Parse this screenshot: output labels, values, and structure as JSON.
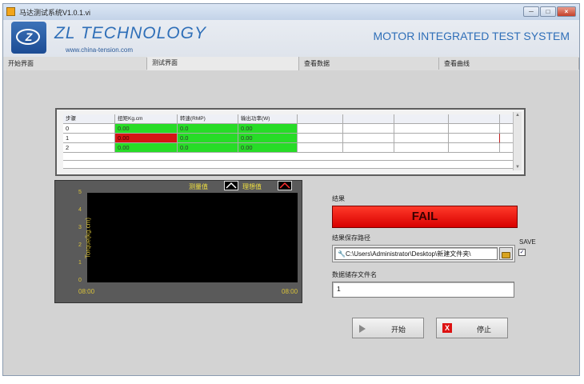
{
  "window": {
    "title": "马达测试系统V1.0.1.vi"
  },
  "header": {
    "logo_letter": "Z",
    "brand": "ZL TECHNOLOGY",
    "url": "www.china-tension.com",
    "system_name": "MOTOR INTEGRATED TEST SYSTEM"
  },
  "tabs": [
    {
      "label": "开始界面"
    },
    {
      "label": "测试界面"
    },
    {
      "label": "查看数据"
    },
    {
      "label": "查看曲线"
    }
  ],
  "table": {
    "columns": [
      "步骤",
      "扭矩Kg.cm",
      "转速(RMP)",
      "输出功率(W)",
      "",
      "",
      "",
      "",
      ""
    ],
    "rows": [
      {
        "step": "0",
        "torque": "0.00",
        "speed": "0.0",
        "power": "0.00",
        "torque_status": "pass"
      },
      {
        "step": "1",
        "torque": "0.00",
        "speed": "0.0",
        "power": "0.00",
        "torque_status": "fail"
      },
      {
        "step": "2",
        "torque": "0.00",
        "speed": "0.0",
        "power": "0.00",
        "torque_status": "pass"
      }
    ],
    "colors": {
      "pass": "#27dc27",
      "fail": "#d41515"
    }
  },
  "chart": {
    "legend": [
      "测量值",
      "理想值"
    ],
    "ylabel": "Torque(kg.cm)",
    "yticks": [
      "5",
      "4",
      "3",
      "2",
      "1",
      "0"
    ],
    "xticks": [
      "08:00",
      "08:00"
    ]
  },
  "result": {
    "label": "结果",
    "value": "FAIL",
    "color": "#ff2a1a"
  },
  "save_path": {
    "label": "结果保存路径",
    "value": "C:\\Users\\Administrator\\Desktop\\新建文件夹\\",
    "save_label": "SAVE",
    "save_checked": true
  },
  "file_name": {
    "label": "数据储存文件名",
    "value": "1"
  },
  "buttons": {
    "start": "开始",
    "stop": "停止",
    "stop_glyph": "X"
  },
  "window_buttons": {
    "minimize": "─",
    "maximize": "□",
    "close": "×"
  }
}
